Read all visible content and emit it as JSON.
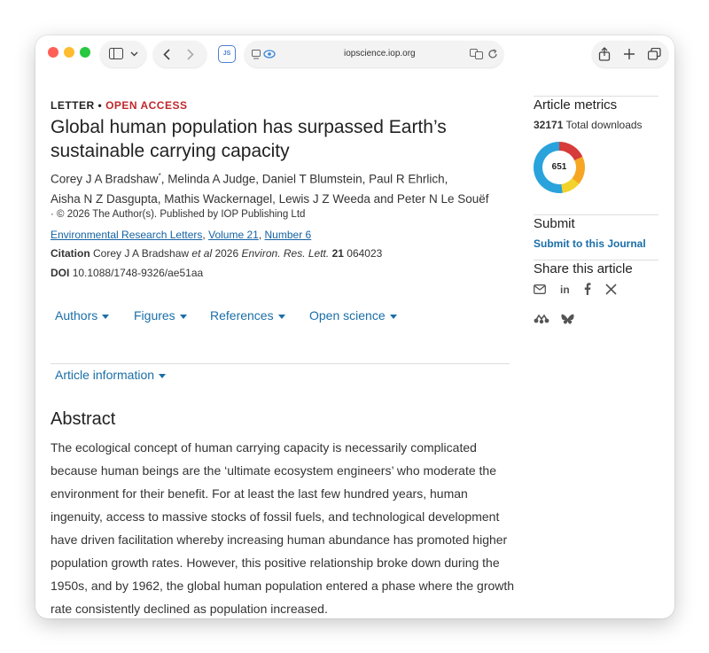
{
  "browser": {
    "url": "iopscience.iop.org",
    "extension_label": "JS"
  },
  "article": {
    "type": "LETTER",
    "separator": "•",
    "access": "OPEN ACCESS",
    "title": "Global human population has surpassed Earth’s sustainable carrying capacity",
    "authors_line1": "Corey J A Bradshaw",
    "first_author_mark": "*",
    "authors_line1_rest": ", Melinda A Judge, Daniel T Blumstein, Paul R Ehrlich,",
    "authors_line2": "Aisha N Z Dasgupta, Mathis Wackernagel, Lewis J Z Weeda and Peter N Le Souëf",
    "copyright": "· © 2026 The Author(s). Published by IOP Publishing Ltd",
    "journal": "Environmental Research Letters",
    "journal_sep1": ",",
    "volume": "Volume 21",
    "journal_sep2": ",",
    "number": "Number 6",
    "citation_label": "Citation",
    "citation_authors": "Corey J A Bradshaw",
    "citation_etal": "et al",
    "citation_year": "2026",
    "citation_journal": "Environ. Res. Lett.",
    "citation_volume": "21",
    "citation_id": "064023",
    "doi_label": "DOI",
    "doi": "10.1088/1748-9326/ae51aa"
  },
  "tabs": [
    {
      "label": "Authors"
    },
    {
      "label": "Figures"
    },
    {
      "label": "References"
    },
    {
      "label": "Open science"
    }
  ],
  "article_information": "Article information",
  "abstract": {
    "heading": "Abstract",
    "text": "The ecological concept of human carrying capacity is necessarily complicated because human beings are the ‘ultimate ecosystem engineers’ who moderate the environment for their benefit. For at least the last few hundred years, human ingenuity, access to massive stocks of fossil fuels, and technological development have driven facilitation whereby increasing human abundance has promoted higher population growth rates. However, this positive relationship broke down during the 1950s, and by 1962, the global human population entered a phase where the growth rate consistently declined as population increased."
  },
  "sidebar": {
    "metrics_heading": "Article metrics",
    "downloads_count": "32171",
    "downloads_label": "Total downloads",
    "altmetric_score": "651",
    "submit_heading": "Submit",
    "submit_link": "Submit to this Journal",
    "share_heading": "Share this article"
  },
  "colors": {
    "accent": "#1a6ea8",
    "open_access": "#c0282d"
  }
}
